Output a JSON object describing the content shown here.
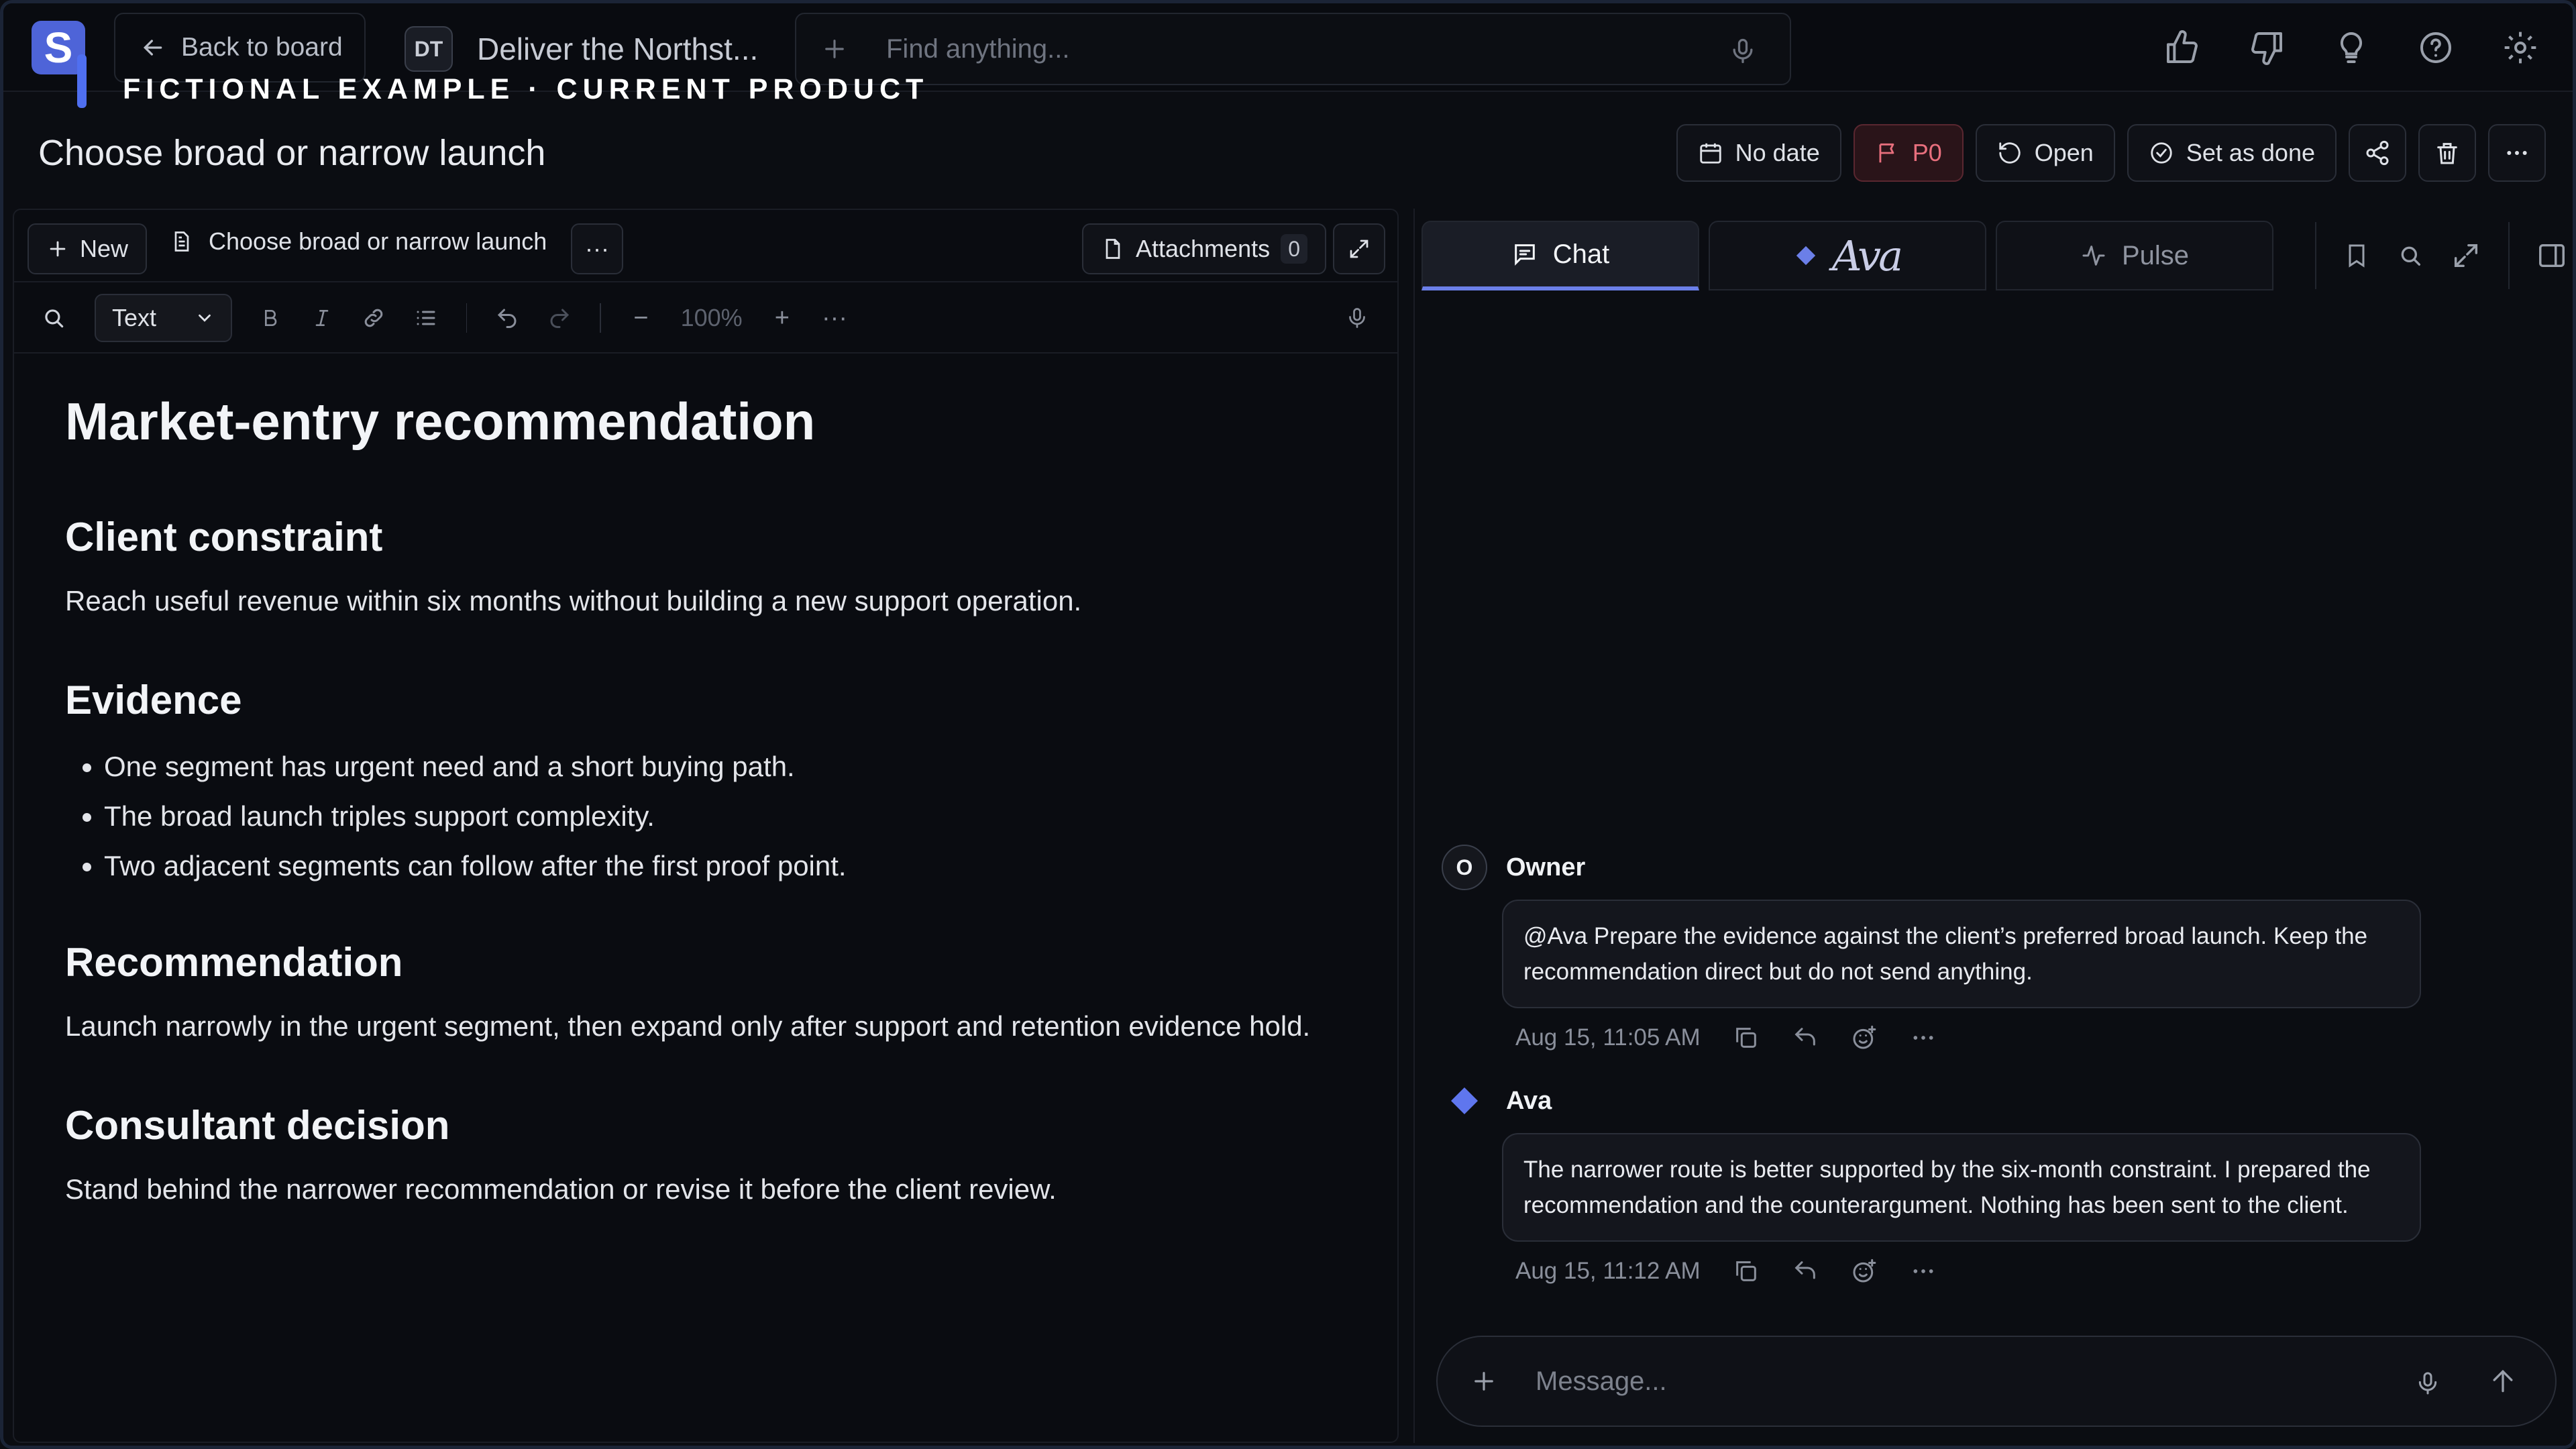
{
  "logo_letter": "S",
  "nav": {
    "back_label": "Back to board",
    "project_initials": "DT",
    "project_name": "Deliver the Northst...",
    "search_placeholder": "Find anything...",
    "top_icons": [
      "thumbs-up-icon",
      "thumbs-down-icon",
      "lightbulb-icon",
      "help-icon",
      "settings-icon"
    ]
  },
  "watermark": "FICTIONAL EXAMPLE · CURRENT PRODUCT",
  "task": {
    "title": "Choose broad or narrow launch",
    "due_label": "No date",
    "priority_label": "P0",
    "status_label": "Open",
    "done_label": "Set as done"
  },
  "colors": {
    "accent": "#6b7fe8",
    "priority": "#e86f7d",
    "background": "#0b0d12"
  },
  "doc_toolbar": {
    "new_label": "New",
    "doc_name": "Choose broad or narrow launch",
    "more_label": "···",
    "attachments_label": "Attachments",
    "attachments_count": "0"
  },
  "format_bar": {
    "text_style": "Text",
    "zoom": "100%",
    "minus": "−",
    "plus": "+",
    "more": "···"
  },
  "document": {
    "title": "Market-entry recommendation",
    "s1_heading": "Client constraint",
    "s1_body": "Reach useful revenue within six months without building a new support operation.",
    "s2_heading": "Evidence",
    "s2_items": [
      "One segment has urgent need and a short buying path.",
      "The broad launch triples support complexity.",
      "Two adjacent segments can follow after the first proof point."
    ],
    "s3_heading": "Recommendation",
    "s3_body": "Launch narrowly in the urgent segment, then expand only after support and retention evidence hold.",
    "s4_heading": "Consultant decision",
    "s4_body": "Stand behind the narrower recommendation or revise it before the client review."
  },
  "chat_tabs": {
    "chat": "Chat",
    "ava": "Ava",
    "pulse": "Pulse"
  },
  "messages": [
    {
      "author": "Owner",
      "avatar": "O",
      "text": "@Ava Prepare the evidence against the client’s preferred broad launch. Keep the recommendation direct but do not send anything.",
      "time": "Aug 15, 11:05 AM"
    },
    {
      "author": "Ava",
      "text": "The narrower route is better supported by the six-month constraint. I prepared the recommendation and the counterargument. Nothing has been sent to the client.",
      "time": "Aug 15, 11:12 AM"
    }
  ],
  "composer": {
    "placeholder": "Message..."
  }
}
